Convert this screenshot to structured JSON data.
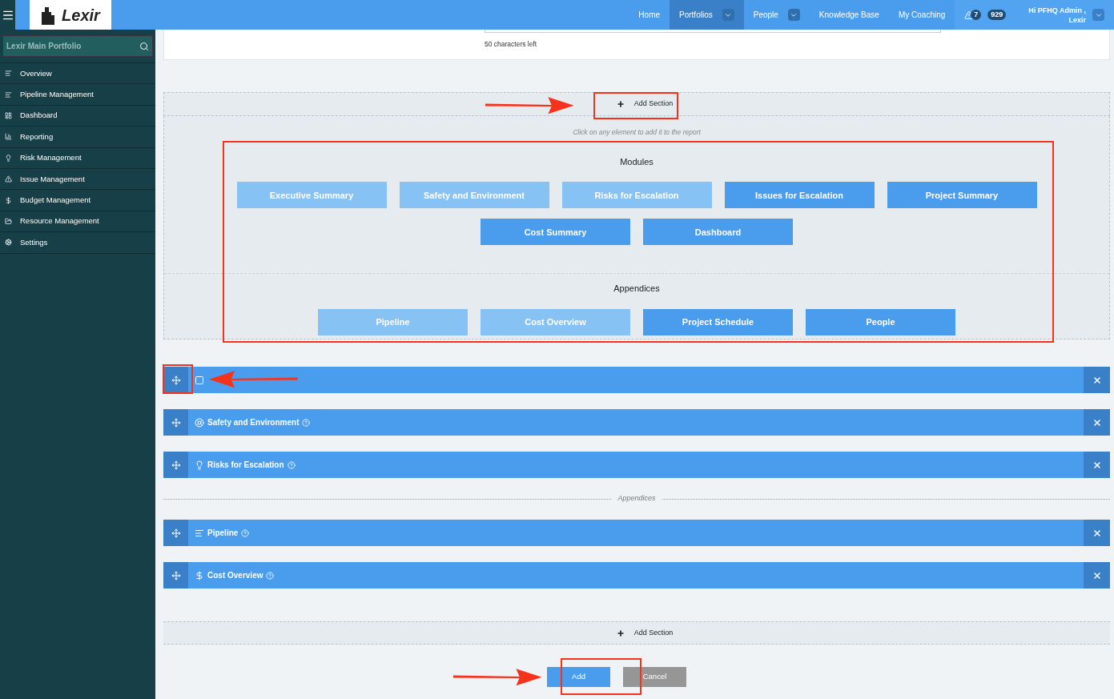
{
  "topbar": {
    "logo": "Lexir",
    "nav": [
      {
        "label": "Home",
        "selected": false,
        "dropdown": false
      },
      {
        "label": "Portfolios",
        "selected": true,
        "dropdown": true
      },
      {
        "label": "People",
        "selected": false,
        "dropdown": true
      },
      {
        "label": "Knowledge Base",
        "selected": false,
        "dropdown": false
      },
      {
        "label": "My Coaching",
        "selected": false,
        "dropdown": false
      }
    ],
    "alerts": "7",
    "notifications": "929",
    "user": [
      "Hi PFHQ Admin ,",
      "Lexir"
    ]
  },
  "sidebar": {
    "portfolio": "Lexir Main Portfolio",
    "items": [
      {
        "label": "Overview",
        "kind": "lines"
      },
      {
        "label": "Pipeline Management",
        "kind": "lines"
      },
      {
        "label": "Dashboard",
        "kind": "dashboard"
      },
      {
        "label": "Reporting",
        "kind": "chart"
      },
      {
        "label": "Risk Management",
        "kind": "bulb"
      },
      {
        "label": "Issue Management",
        "kind": "warning"
      },
      {
        "label": "Budget Management",
        "kind": "dollar"
      },
      {
        "label": "Resource Management",
        "kind": "folder"
      },
      {
        "label": "Settings",
        "kind": "gears"
      }
    ]
  },
  "chars_left": "50 characters left",
  "add_section": "Add Section",
  "hint": "Click on any element to add it to the report",
  "palette": [
    {
      "title": "Modules",
      "rows": [
        [
          {
            "label": "Executive Summary",
            "disabled": true
          },
          {
            "label": "Safety and Environment",
            "disabled": true
          },
          {
            "label": "Risks for Escalation",
            "disabled": true
          },
          {
            "label": "Issues for Escalation",
            "disabled": false
          },
          {
            "label": "Project Summary",
            "disabled": false
          }
        ],
        [
          {
            "label": "Cost Summary",
            "disabled": false
          },
          {
            "label": "Dashboard",
            "disabled": false
          }
        ]
      ]
    },
    {
      "title": "Appendices",
      "rows": [
        [
          {
            "label": "Pipeline",
            "disabled": true
          },
          {
            "label": "Cost Overview",
            "disabled": true
          },
          {
            "label": "Project Schedule",
            "disabled": false
          },
          {
            "label": "People",
            "disabled": false
          }
        ]
      ]
    }
  ],
  "sections": [
    {
      "kind": "summary"
    },
    {
      "title": "Safety and Environment",
      "kind": "lifebuoy"
    },
    {
      "title": "Risks for Escalation",
      "kind": "bulb"
    }
  ],
  "appendices_label": "Appendices",
  "appendices": [
    {
      "title": "Pipeline",
      "kind": "lines"
    },
    {
      "title": "Cost Overview",
      "kind": "dollar"
    }
  ],
  "add_section_bottom": "Add Section",
  "buttons": {
    "add": "Add",
    "cancel": "Cancel"
  }
}
